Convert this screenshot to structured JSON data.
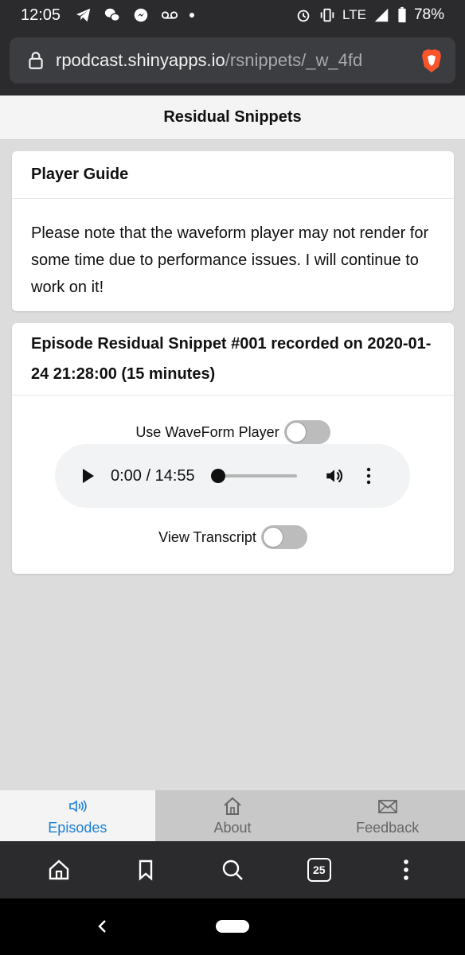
{
  "status_bar": {
    "time": "12:05",
    "network": "LTE",
    "battery": "78%"
  },
  "url_bar": {
    "host": "rpodcast.shinyapps.io",
    "path": "/rsnippets/_w_4fd"
  },
  "app": {
    "title": "Residual Snippets"
  },
  "player_guide": {
    "title": "Player Guide",
    "body": "Please note that the waveform player may not render for some time due to performance issues. I will continue to work on it!"
  },
  "episode": {
    "title": "Episode Residual Snippet #001 recorded on 2020-01-24 21:28:00 (15 minutes)",
    "waveform_label": "Use WaveForm Player",
    "waveform_enabled": false,
    "audio_time": "0:00 / 14:55",
    "audio_progress": 0,
    "transcript_label": "View Transcript",
    "transcript_enabled": false
  },
  "tabs": [
    {
      "label": "Episodes",
      "icon": "speaker-icon",
      "active": true
    },
    {
      "label": "About",
      "icon": "home-icon",
      "active": false
    },
    {
      "label": "Feedback",
      "icon": "envelope-icon",
      "active": false
    }
  ],
  "browser_toolbar": {
    "tab_count": "25"
  },
  "colors": {
    "accent": "#1a7fd6",
    "chrome": "#2b2b2e",
    "background": "#dcdcdc"
  }
}
